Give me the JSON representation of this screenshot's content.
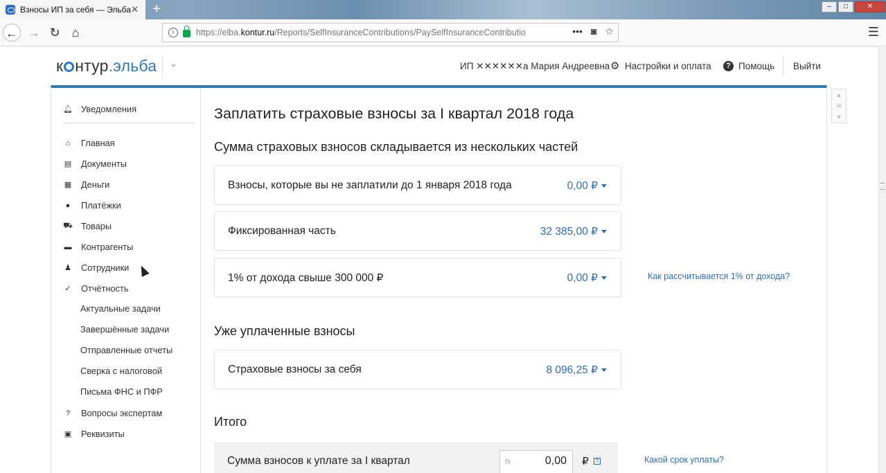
{
  "browser": {
    "tab_title": "Взносы ИП за себя — Эльба",
    "tab_close": "✕",
    "new_tab": "+",
    "url_prefix": "https://elba.",
    "url_domain": "kontur.ru",
    "url_path": "/Reports/SelfInsuranceContributions/PaySelfInsuranceContributio",
    "url_actions": [
      "•••",
      "◙",
      "☆"
    ]
  },
  "header": {
    "logo_left": "к",
    "logo_mid": "нтур",
    "logo_dot": ".эльба",
    "user": "ИП ✕✕✕✕✕✕а Мария Андреевна",
    "settings": "Настройки и оплата",
    "help": "Помощь",
    "logout": "Выйти"
  },
  "sidebar": {
    "notifications": "Уведомления",
    "items": [
      {
        "label": "Главная",
        "icon": "home-icon",
        "glyph": "⌂"
      },
      {
        "label": "Документы",
        "icon": "document-icon",
        "glyph": "▤"
      },
      {
        "label": "Деньги",
        "icon": "money-icon",
        "glyph": "▦"
      },
      {
        "label": "Платёжки",
        "icon": "payment-icon",
        "glyph": "●"
      },
      {
        "label": "Товары",
        "icon": "cart-icon",
        "glyph": "⛟"
      },
      {
        "label": "Контрагенты",
        "icon": "briefcase-icon",
        "glyph": "▬"
      },
      {
        "label": "Сотрудники",
        "icon": "person-icon",
        "glyph": "♟"
      },
      {
        "label": "Отчётность",
        "icon": "reports-icon",
        "glyph": "✓"
      }
    ],
    "subitems": [
      "Актуальные задачи",
      "Завершённые задачи",
      "Отправленные отчеты",
      "Сверка с налоговой",
      "Письма ФНС и ПФР"
    ],
    "bottom": [
      {
        "label": "Вопросы экспертам",
        "icon": "question-icon",
        "glyph": "?"
      },
      {
        "label": "Реквизиты",
        "icon": "details-icon",
        "glyph": "▣"
      }
    ]
  },
  "main": {
    "title": "Заплатить страховые взносы за I квартал 2018 года",
    "parts_heading": "Сумма страховых взносов складывается из нескольких частей",
    "parts": [
      {
        "label": "Взносы, которые вы не заплатили до 1 января 2018 года",
        "value": "0,00 ₽"
      },
      {
        "label": "Фиксированная часть",
        "value": "32 385,00 ₽"
      },
      {
        "label": "1% от дохода свыше 300 000 ₽",
        "value": "0,00 ₽"
      }
    ],
    "one_percent_link": "Как рассчитывается 1% от дохода?",
    "paid_heading": "Уже уплаченные взносы",
    "paid": [
      {
        "label": "Страховые взносы за себя",
        "value": "8 096,25 ₽"
      }
    ],
    "total_heading": "Итого",
    "total_label": "Сумма взносов к уплате за I квартал",
    "total_value": "0,00",
    "total_currency": "₽",
    "fx": "fx",
    "deadline_link": "Какой срок уплаты?"
  }
}
